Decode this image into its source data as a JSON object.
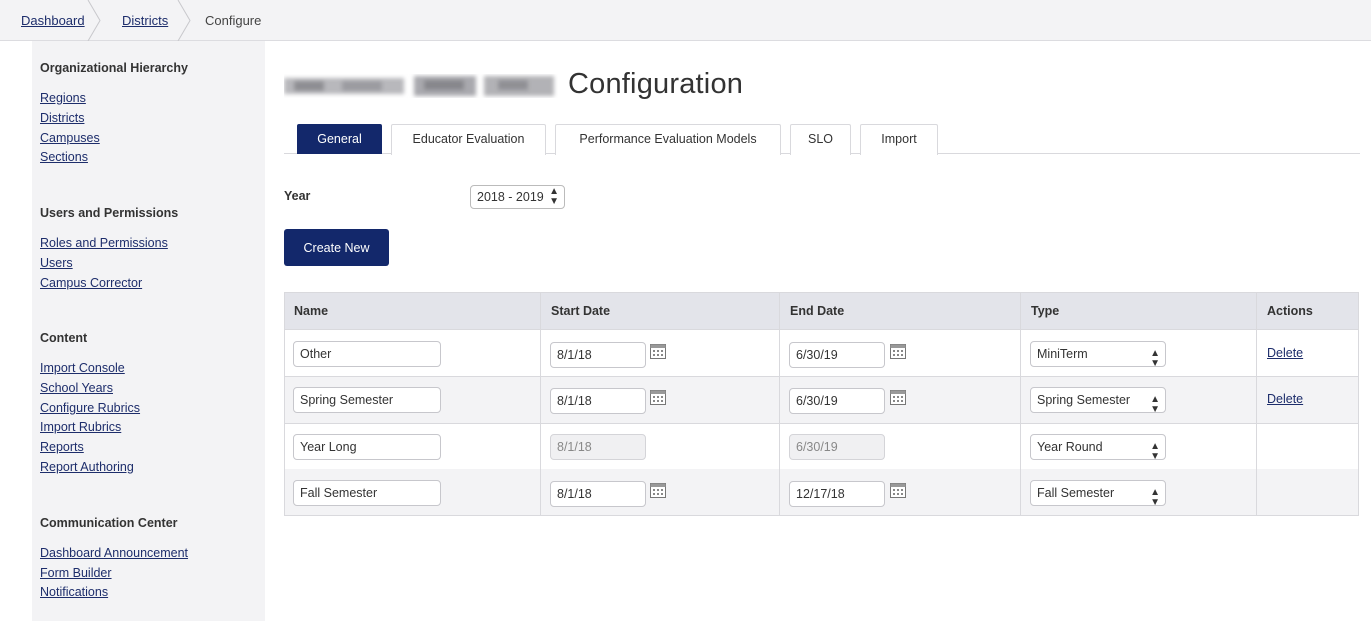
{
  "breadcrumb": {
    "items": [
      "Dashboard",
      "Districts",
      "Configure"
    ]
  },
  "sidebar": {
    "sections": [
      {
        "heading": "Organizational Hierarchy",
        "links": [
          "Regions",
          "Districts",
          "Campuses",
          "Sections"
        ]
      },
      {
        "heading": "Users and Permissions",
        "links": [
          "Roles and Permissions",
          "Users",
          "Campus Corrector"
        ]
      },
      {
        "heading": "Content",
        "links": [
          "Import Console",
          "School Years",
          "Configure Rubrics",
          "Import Rubrics",
          "Reports",
          "Report Authoring"
        ]
      },
      {
        "heading": "Communication Center",
        "links": [
          "Dashboard Announcement",
          "Form Builder",
          "Notifications"
        ]
      }
    ]
  },
  "page": {
    "title": "Configuration"
  },
  "tabs": [
    "General",
    "Educator Evaluation",
    "Performance Evaluation Models",
    "SLO",
    "Import"
  ],
  "active_tab": "General",
  "year": {
    "label": "Year",
    "value": "2018 - 2019"
  },
  "create_button": "Create New",
  "table": {
    "columns": [
      "Name",
      "Start Date",
      "End Date",
      "Type",
      "Actions"
    ],
    "rows": [
      {
        "name": "Other",
        "start": "8/1/18",
        "end": "6/30/19",
        "type": "MiniTerm",
        "action": "Delete",
        "editable": true
      },
      {
        "name": "Spring Semester",
        "start": "8/1/18",
        "end": "6/30/19",
        "type": "Spring Semester",
        "action": "Delete",
        "editable": true
      },
      {
        "name": "Year Long",
        "start": "8/1/18",
        "end": "6/30/19",
        "type": "Year Round",
        "action": "",
        "editable": false
      },
      {
        "name": "Fall Semester",
        "start": "8/1/18",
        "end": "12/17/18",
        "type": "Fall Semester",
        "action": "",
        "editable": true
      }
    ]
  },
  "colors": {
    "primary": "#13286b",
    "link": "#1d2d6b",
    "panel": "#f3f3f5"
  }
}
